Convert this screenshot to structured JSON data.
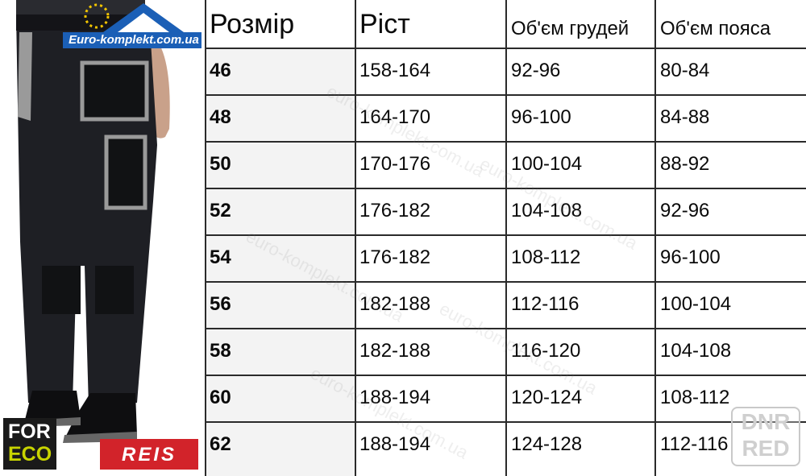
{
  "brand": {
    "logo_text": "Euro-komplekt.com.ua",
    "watermark_text": "euro-komplekt.com.ua",
    "badge_foreco_line1": "FOR",
    "badge_foreco_line2": "ECO",
    "badge_reis": "REIS",
    "badge_dnr_line1": "DNR",
    "badge_dnr_line2": "RED"
  },
  "size_table": {
    "headers": [
      "Розмір",
      "Ріст",
      "Об'єм грудей",
      "Об'єм пояса"
    ],
    "rows": [
      [
        "46",
        "158-164",
        "92-96",
        "80-84"
      ],
      [
        "48",
        "164-170",
        "96-100",
        "84-88"
      ],
      [
        "50",
        "170-176",
        "100-104",
        "88-92"
      ],
      [
        "52",
        "176-182",
        "104-108",
        "92-96"
      ],
      [
        "54",
        "176-182",
        "108-112",
        "96-100"
      ],
      [
        "56",
        "182-188",
        "112-116",
        "100-104"
      ],
      [
        "58",
        "182-188",
        "116-120",
        "104-108"
      ],
      [
        "60",
        "188-194",
        "120-124",
        "108-112"
      ],
      [
        "62",
        "188-194",
        "124-128",
        "112-116"
      ]
    ]
  },
  "colors": {
    "logo_blue": "#1b5fb6",
    "reis_red": "#d2232a",
    "foreco_green": "#c8d400",
    "trousers_dark": "#1e1f24",
    "trousers_accent": "#9a9a9a"
  }
}
